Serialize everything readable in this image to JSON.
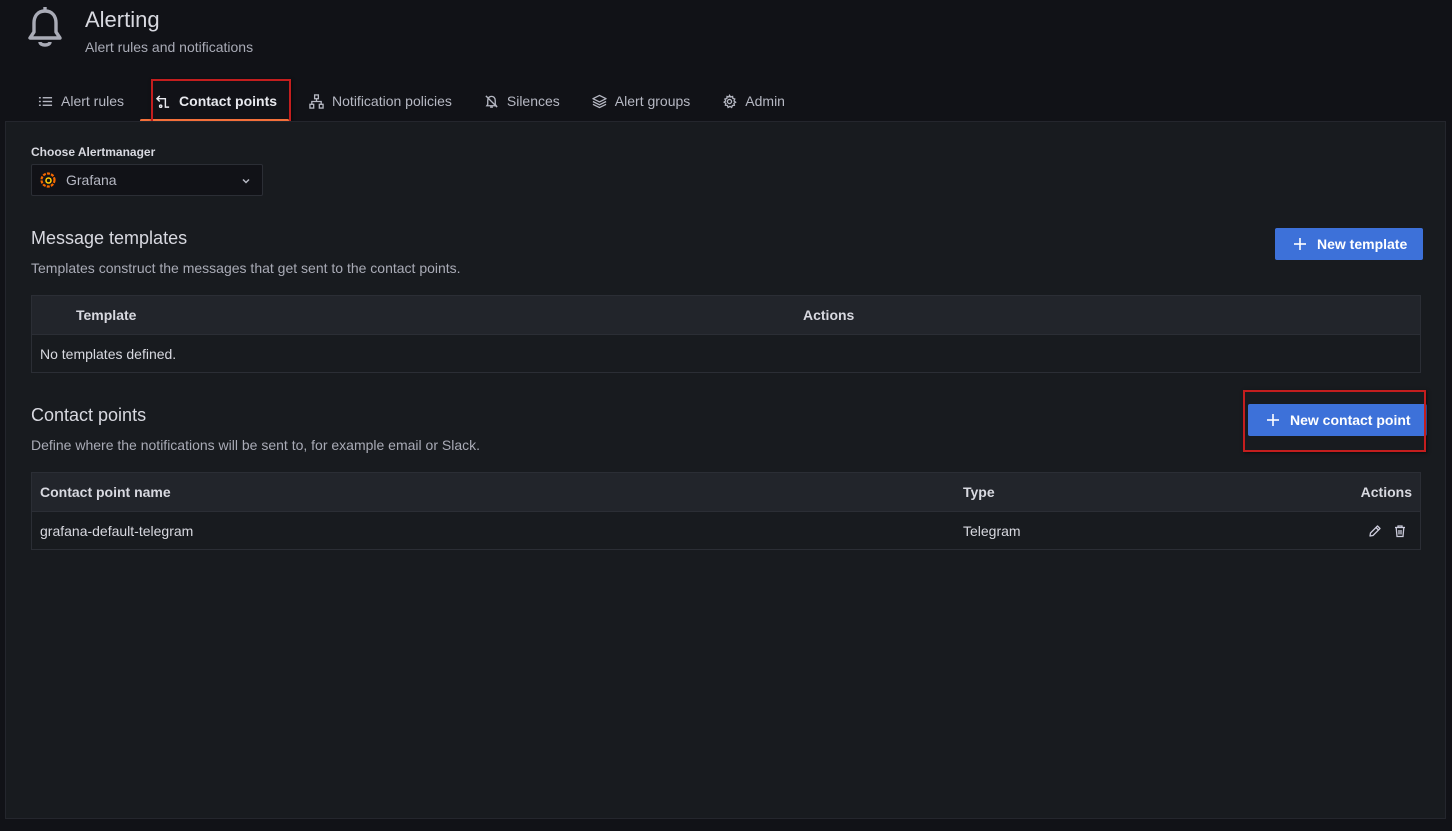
{
  "header": {
    "title": "Alerting",
    "subtitle": "Alert rules and notifications",
    "icon": "bell-icon"
  },
  "tabs": [
    {
      "label": "Alert rules",
      "icon": "list-icon",
      "active": false
    },
    {
      "label": "Contact points",
      "icon": "contact-points-icon",
      "active": true
    },
    {
      "label": "Notification policies",
      "icon": "sitemap-icon",
      "active": false
    },
    {
      "label": "Silences",
      "icon": "bell-slash-icon",
      "active": false
    },
    {
      "label": "Alert groups",
      "icon": "layers-icon",
      "active": false
    },
    {
      "label": "Admin",
      "icon": "cog-icon",
      "active": false
    }
  ],
  "alertmanager": {
    "label": "Choose Alertmanager",
    "selected": "Grafana"
  },
  "templates": {
    "title": "Message templates",
    "description": "Templates construct the messages that get sent to the contact points.",
    "new_button": "New template",
    "columns": [
      "Template",
      "Actions"
    ],
    "empty": "No templates defined."
  },
  "contact_points": {
    "title": "Contact points",
    "description": "Define where the notifications will be sent to, for example email or Slack.",
    "new_button": "New contact point",
    "columns": [
      "Contact point name",
      "Type",
      "Actions"
    ],
    "rows": [
      {
        "name": "grafana-default-telegram",
        "type": "Telegram"
      }
    ]
  },
  "colors": {
    "accent": "#f4703a",
    "primary": "#3d71d9",
    "highlight": "#c41e1e",
    "background": "#111217",
    "panel": "#181b1f"
  }
}
